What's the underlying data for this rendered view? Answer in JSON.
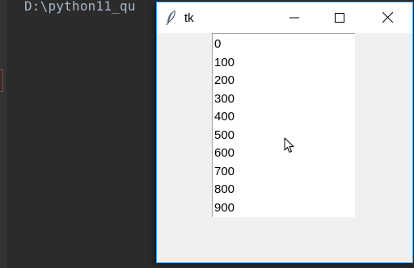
{
  "console": {
    "path_text": "D:\\python11_qu"
  },
  "window": {
    "title": "tk",
    "icon": "feather-icon",
    "controls": [
      "minimize-icon",
      "maximize-icon",
      "close-icon"
    ]
  },
  "listbox": {
    "items": [
      "0",
      "100",
      "200",
      "300",
      "400",
      "500",
      "600",
      "700",
      "800",
      "900"
    ]
  },
  "colors": {
    "ide_background": "#2b2b2b",
    "window_border": "#3c9be0",
    "window_background": "#f0f0f0",
    "listbox_background": "#ffffff"
  }
}
